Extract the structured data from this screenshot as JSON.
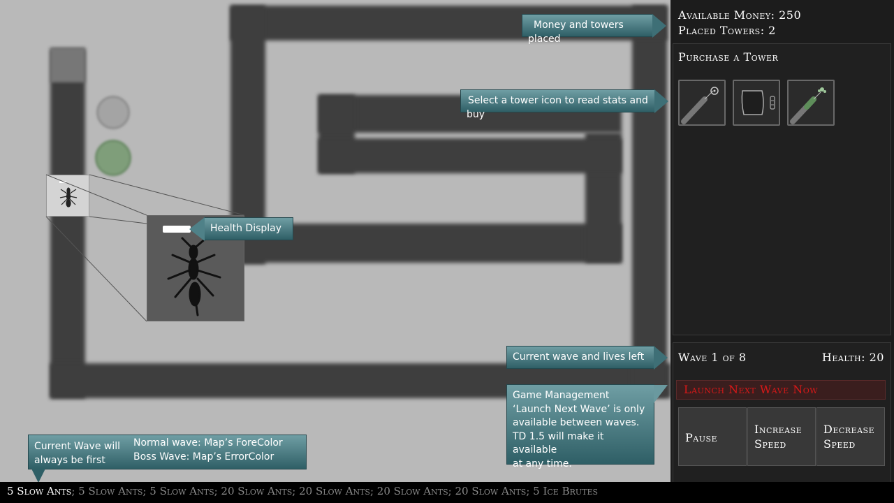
{
  "callouts": {
    "money": "Money and towers placed",
    "select_tower": "Select a tower icon to read stats and buy",
    "health_display": "Health Display",
    "wave_lives": "Current wave and lives left",
    "game_management": [
      "Game Management",
      "‘Launch Next Wave’ is only",
      "available between waves.",
      "TD 1.5 will make it available",
      "at any time."
    ],
    "current_wave_first": [
      "Current Wave will",
      "always be first"
    ],
    "wave_colors": [
      "Normal wave:  Map’s ForeColor",
      "Boss Wave:  Map’s ErrorColor"
    ]
  },
  "sidebar": {
    "available_money_label": "Available Money: 250",
    "placed_towers_label": "Placed Towers: 2",
    "purchase_heading": "Purchase a Tower",
    "towers": [
      {
        "icon": "dart-tower-icon"
      },
      {
        "icon": "cannon-tower-icon"
      },
      {
        "icon": "frost-tower-icon"
      }
    ],
    "wave_label": "Wave 1 of 8",
    "health_label": "Health: 20",
    "launch_label": "Launch Next Wave Now",
    "pause_label": "Pause",
    "increase_label": [
      "Increase",
      "Speed"
    ],
    "decrease_label": [
      "Decrease",
      "Speed"
    ]
  },
  "ticker": {
    "current": "5 Slow Ants",
    "rest": "; 5 Slow Ants; 5 Slow Ants; 20 Slow Ants; 20 Slow Ants; 20 Slow Ants; 20 Slow Ants; 5 Ice Brutes"
  },
  "colors": {
    "launch_text": "#d81818",
    "callout_top": "#6f9ea4",
    "callout_bottom": "#2f5f66",
    "path": "#3e3e3e",
    "map_background": "#b9b9b9"
  }
}
